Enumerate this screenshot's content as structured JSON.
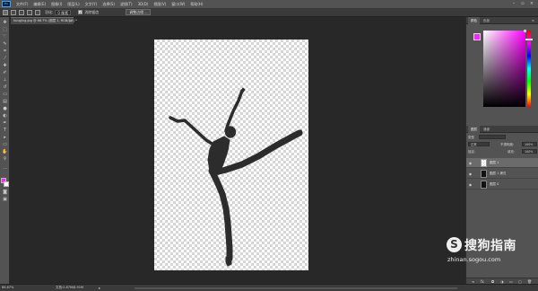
{
  "menubar": {
    "items": [
      "文件(F)",
      "编辑(E)",
      "图像(I)",
      "图层(L)",
      "文字(Y)",
      "选择(S)",
      "滤镜(T)",
      "3D(D)",
      "视图(V)",
      "窗口(W)",
      "帮助(H)"
    ]
  },
  "options": {
    "feather_label": "羽化:",
    "feather_value": "0 像素",
    "antialias_label": "消除锯齿",
    "refine_button": "调整边缘..."
  },
  "document": {
    "tab_title": "tongjing.jpg @ 66.7% (图层 1, RGB/8#) *",
    "close": "×"
  },
  "status": {
    "zoom": "66.67%",
    "doc_info": "文档:2.87M/8.91M"
  },
  "panels": {
    "color_tabs": [
      "颜色",
      "色板"
    ],
    "layer_tabs": [
      "图层",
      "通道"
    ],
    "kind_label": "类型",
    "blend_mode": "正常",
    "opacity_label": "不透明度:",
    "opacity_value": "100%",
    "lock_label": "锁定:",
    "fill_label": "填充:",
    "fill_value": "100%",
    "layers": [
      {
        "name": "图层 1",
        "selected": true,
        "thumb": "transparent"
      },
      {
        "name": "图层 1 拷贝",
        "selected": false,
        "thumb": "dark"
      },
      {
        "name": "图层 0",
        "selected": false,
        "thumb": "dark"
      }
    ]
  },
  "colors": {
    "foreground": "#ff22ff",
    "background": "#ffffff"
  },
  "watermark": {
    "logo_glyph": "S",
    "title": "搜狗指南",
    "url": "zhinan.sogou.com"
  }
}
